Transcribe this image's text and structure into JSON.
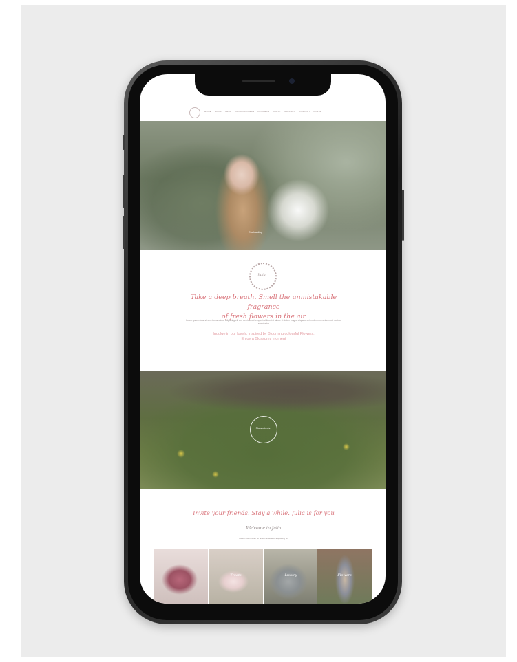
{
  "nav": {
    "items": [
      "HOME",
      "BLOG",
      "SHOP",
      "BOOK FLOWERS",
      "FLOWERS",
      "ABOUT",
      "GALLERY",
      "CONTACT",
      "LOGIN"
    ]
  },
  "hero": {
    "label": "Enchanting"
  },
  "intro": {
    "wreath_text": "Julia",
    "heading_line1": "Take a deep breath. Smell the unmistakable fragrance",
    "heading_line2": "of fresh flowers in the air",
    "body": "Lorem ipsum dolor sit amet consectetur adipiscing elit sed do eiusmod tempor incididunt ut labore et dolore magna aliqua ut enim ad minim veniam quis nostrud exercitation",
    "pink_line1": "Indulge in our lovely, inspired by Blooming colourful Flowers,",
    "pink_line2": "Enjoy a Blossomy moment"
  },
  "forest": {
    "label": "Flowerbeds"
  },
  "invite": {
    "heading": "Invite your friends. Stay a while. Julia is for you",
    "welcome": "Welcome to Julia",
    "subtext": "Lorem ipsum dolor sit amet consectetur adipiscing elit"
  },
  "thumbs": [
    {
      "caption": ""
    },
    {
      "caption": "Treats"
    },
    {
      "caption": "Luxury"
    },
    {
      "caption": "Flowers"
    }
  ],
  "colors": {
    "accent_pink": "#d9747b",
    "frame_bg": "#ececec"
  }
}
